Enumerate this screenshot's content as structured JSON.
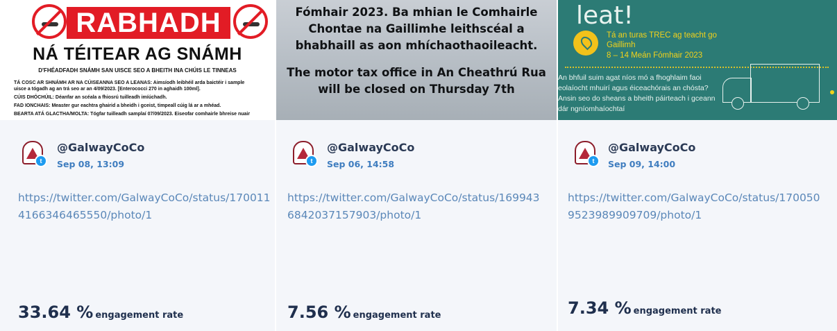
{
  "cards": [
    {
      "thumb": {
        "banner": "RABHADH",
        "headline": "NÁ TÉITEAR AG SNÁMH",
        "subheading": "D'FHÉADFADH SNÁMH SAN UISCE SEO A BHEITH INA CHÚIS LE TINNEAS",
        "notice_lines": [
          "TÁ COSC AR SHNÁMH AR NA CÚISEANNA SEO A LEANAS: Aimsíodh leibhéil arda baictéir i sample",
          "uisce a tógadh ag an trá seo ar an 4/09/2023. [Enterococci 270 in aghaidh 100ml].",
          "CÚIS DHÓCHÚIL: Déanfar an scéala a fhiosrú tuilleadh imíúchadh.",
          "FAD IONCHAIS: Measter gur eachtra ghairid a bheidh i gceist, timpeall cúig lá ar a mhéad.",
          "BEARTA ATÁ GLACTHA/MOLTA: Tógfar tuilleadh samplaí 07/09/2023. Eiseofar comhairle bhreise nuair"
        ]
      },
      "handle": "@GalwayCoCo",
      "date": "Sep 08, 13:09",
      "url": "https://twitter.com/GalwayCoCo/status/170011 4166346465550/photo/1",
      "rate_value": "33.64 %",
      "rate_label": "engagement rate"
    },
    {
      "thumb": {
        "lines_irish": [
          "Fómhair 2023. Ba mhian le Comhairle",
          "Chontae na Gaillimhe leithscéal a",
          "bhabhaill as aon mhíchaothaoileacht."
        ],
        "lines_english": [
          "The motor tax office in An Cheathrú Rua",
          "will be closed on Thursday 7th"
        ]
      },
      "handle": "@GalwayCoCo",
      "date": "Sep 06, 14:58",
      "url": "https://twitter.com/GalwayCoCo/status/169943 6842037157903/photo/1",
      "rate_value": "7.56 %",
      "rate_label": "engagement rate"
    },
    {
      "thumb": {
        "leat": "leat!",
        "line1": "Tá an turas TREC ag teacht go Gaillimh",
        "line2": "8 – 14 Meán Fómhair 2023",
        "paragraph": "An bhfuil suim agat níos mó a fhoghlaim faoi eolaíocht mhuirí agus éiceachórais an chósta? Ansin seo do sheans a bheith páirteach i gceann dár ngníomhaíochtaí"
      },
      "handle": "@GalwayCoCo",
      "date": "Sep 09, 14:00",
      "url": "https://twitter.com/GalwayCoCo/status/170050 9523989909709/photo/1",
      "rate_value": "7.34 %",
      "rate_label": "engagement rate"
    }
  ],
  "icons": {
    "avatar": "galway-county-council-crest",
    "badge": "twitter-bird-icon"
  },
  "colors": {
    "handle": "#2b3a55",
    "date": "#3f7dbf",
    "url": "#5a87b8",
    "rate": "#1f2f4d",
    "warning_red": "#e21c25",
    "trec_teal": "#2c7b75"
  }
}
